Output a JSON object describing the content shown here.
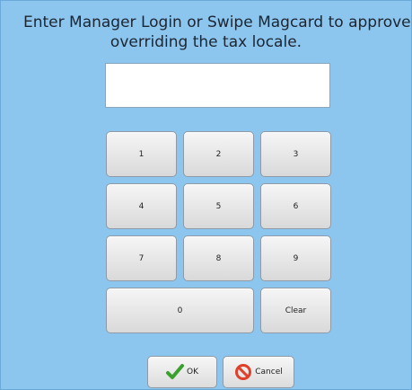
{
  "prompt": {
    "line1": "Enter Manager Login or Swipe Magcard  to approve",
    "line2": "overriding the tax locale."
  },
  "input": {
    "value": ""
  },
  "keypad": {
    "k1": "1",
    "k2": "2",
    "k3": "3",
    "k4": "4",
    "k5": "5",
    "k6": "6",
    "k7": "7",
    "k8": "8",
    "k9": "9",
    "k0": "0",
    "clear": "Clear"
  },
  "actions": {
    "ok_label": "OK",
    "cancel_label": "Cancel"
  },
  "icons": {
    "ok": "checkmark-icon",
    "cancel": "no-symbol-icon"
  },
  "colors": {
    "background": "#8cc6ef",
    "ok_icon": "#3aa12f",
    "cancel_icon": "#e0402a"
  }
}
